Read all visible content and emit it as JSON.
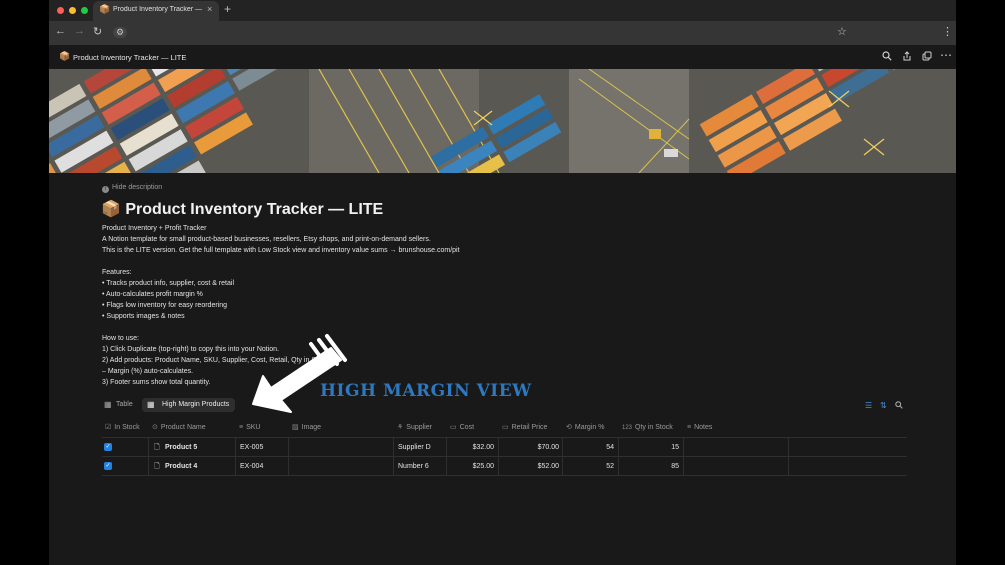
{
  "browser": {
    "tab_emoji": "📦",
    "tab_title": "Product Inventory Tracker — ...",
    "tab_close": "×",
    "new_tab": "+",
    "nav": {
      "back": "←",
      "forward": "→",
      "reload": "↻",
      "site_info": "⚙",
      "bookmark": "☆",
      "menu": "⋮"
    },
    "colors": {
      "close": "#ff5f57",
      "minimize": "#febc2e",
      "maximize": "#28c840"
    }
  },
  "page_header": {
    "emoji": "📦",
    "title": "Product Inventory Tracker — LITE",
    "icons": [
      "search-icon",
      "share-icon",
      "duplicate-icon",
      "more-icon"
    ]
  },
  "page": {
    "hide_description": "Hide description",
    "title_emoji": "📦",
    "title": "Product Inventory Tracker — LITE",
    "description": [
      "Product Inventory + Profit Tracker",
      "A Notion template for small product-based businesses, resellers, Etsy shops, and print-on-demand sellers.",
      "This is the LITE version. Get the full template with Low Stock view and inventory value sums → brunshouse.com/pit",
      "",
      "Features:",
      "• Tracks product info, supplier, cost & retail",
      "• Auto-calculates profit margin %",
      "• Flags low inventory for easy reordering",
      "• Supports images & notes",
      "",
      "How to use:",
      "1) Click Duplicate (top-right) to copy this into your Notion.",
      "2) Add products: Product Name, SKU, Supplier, Cost, Retail, Qty in Stock.",
      "– Margin (%) auto-calculates.",
      "3) Footer sums show total quantity."
    ]
  },
  "overlay": {
    "headline": "HIGH MARGIN VIEW"
  },
  "views": {
    "table": "Table",
    "high_margin": "High Margin Products",
    "accent": "#4a8fd8"
  },
  "table": {
    "columns": [
      {
        "icon": "☑",
        "label": "In Stock"
      },
      {
        "icon": "⊙",
        "label": "Product Name"
      },
      {
        "icon": "≡",
        "label": "SKU"
      },
      {
        "icon": "▨",
        "label": "Image"
      },
      {
        "icon": "⚘",
        "label": "Supplier"
      },
      {
        "icon": "▭",
        "label": "Cost"
      },
      {
        "icon": "▭",
        "label": "Retail Price"
      },
      {
        "icon": "⟲",
        "label": "Margin %"
      },
      {
        "icon": "123",
        "label": "Qty in Stock"
      },
      {
        "icon": "≡",
        "label": "Notes"
      }
    ],
    "rows": [
      {
        "in_stock": true,
        "product": "Product 5",
        "sku": "EX-005",
        "supplier": "Supplier D",
        "cost": "$32.00",
        "retail": "$70.00",
        "margin": "54",
        "qty": "15"
      },
      {
        "in_stock": true,
        "product": "Product 4",
        "sku": "EX-004",
        "supplier": "Number 6",
        "cost": "$25.00",
        "retail": "$52.00",
        "margin": "52",
        "qty": "85"
      }
    ]
  }
}
